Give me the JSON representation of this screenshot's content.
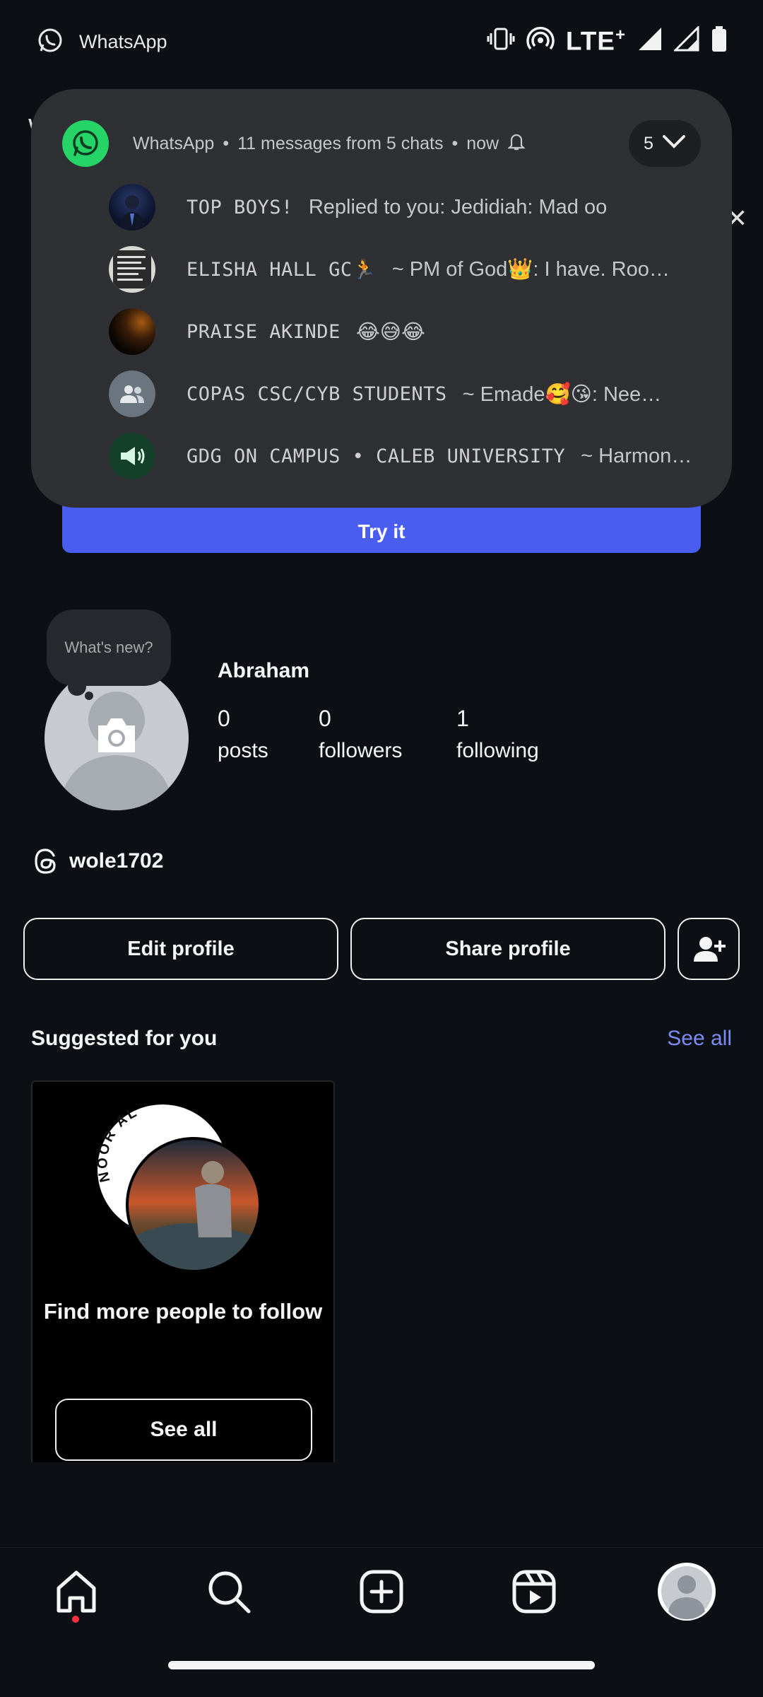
{
  "status_bar": {
    "app_name": "WhatsApp",
    "network": "LTE",
    "network_suffix": "+"
  },
  "notification": {
    "app": "WhatsApp",
    "summary": "11 messages from 5 chats",
    "time": "now",
    "count": "5",
    "rows": [
      {
        "name": "TOP BOYS!",
        "message": "Replied to you:  Jedidiah: Mad oo"
      },
      {
        "name": "ELISHA HALL GC🏃",
        "message": "~ PM of God👑: I have. Roo…"
      },
      {
        "name": "PRAISE AKINDE",
        "message": "😂😅😂"
      },
      {
        "name": "COPAS CSC/CYB STUDENTS",
        "message": "~ Emade🥰😘: Nee…"
      },
      {
        "name": "GDG ON CAMPUS • CALEB UNIVERSITY",
        "message": "~ Harmony…"
      }
    ]
  },
  "promo": {
    "try_label": "Try it"
  },
  "profile": {
    "bubble": "What's new?",
    "display_name": "Abraham",
    "stats": [
      {
        "value": "0",
        "label": "posts"
      },
      {
        "value": "0",
        "label": "followers"
      },
      {
        "value": "1",
        "label": "following"
      }
    ],
    "threads_handle": "wole1702",
    "edit_label": "Edit profile",
    "share_label": "Share profile"
  },
  "suggested": {
    "title": "Suggested for you",
    "see_all": "See all",
    "card_text": "Find more people to follow",
    "card_button": "See all",
    "logo_text": "NOOR AL"
  },
  "colors": {
    "background": "#0c1014",
    "accent": "#4a5df1",
    "link": "#7c8cf5",
    "whatsapp": "#25d366",
    "notification_bg": "#2f3033"
  },
  "nav": {
    "items": [
      "home-icon",
      "search-icon",
      "create-icon",
      "reels-icon",
      "profile-icon"
    ]
  }
}
